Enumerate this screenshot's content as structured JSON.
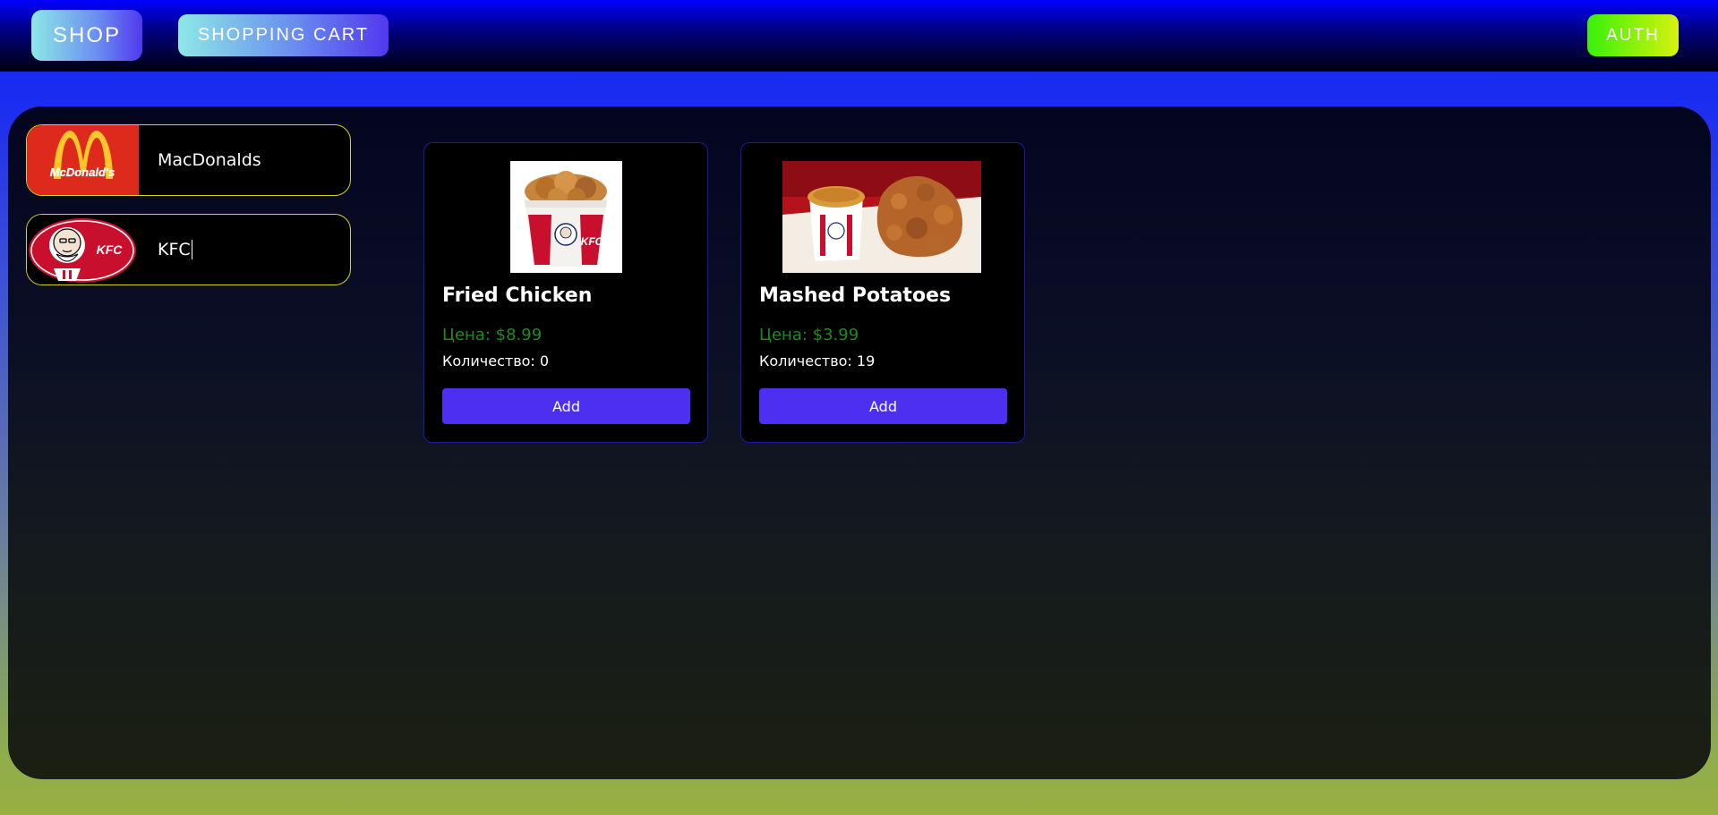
{
  "nav": {
    "shop_label": "SHOP",
    "cart_label": "SHOPPING CART",
    "auth_label": "AUTH"
  },
  "stores": [
    {
      "name": "MacDonalds",
      "logo_text": "McDonald's",
      "logo_icon": "mcdonalds-logo"
    },
    {
      "name": "KFC",
      "logo_text": "KFC",
      "logo_icon": "kfc-logo"
    }
  ],
  "products": [
    {
      "title": "Fried Chicken",
      "price": "Цена: $8.99",
      "quantity": "Количество: 0",
      "button": "Add",
      "image_icon": "fried-chicken-bucket-image",
      "bucket_text": "KFC"
    },
    {
      "title": "Mashed Potatoes",
      "price": "Цена: $3.99",
      "quantity": "Количество: 19",
      "button": "Add",
      "image_icon": "mashed-potatoes-image"
    }
  ],
  "colors": {
    "accent": "#4c2ff0",
    "price": "#1f8b1f",
    "store_border": "#d6d41a",
    "card_border": "#1a1aa8"
  }
}
